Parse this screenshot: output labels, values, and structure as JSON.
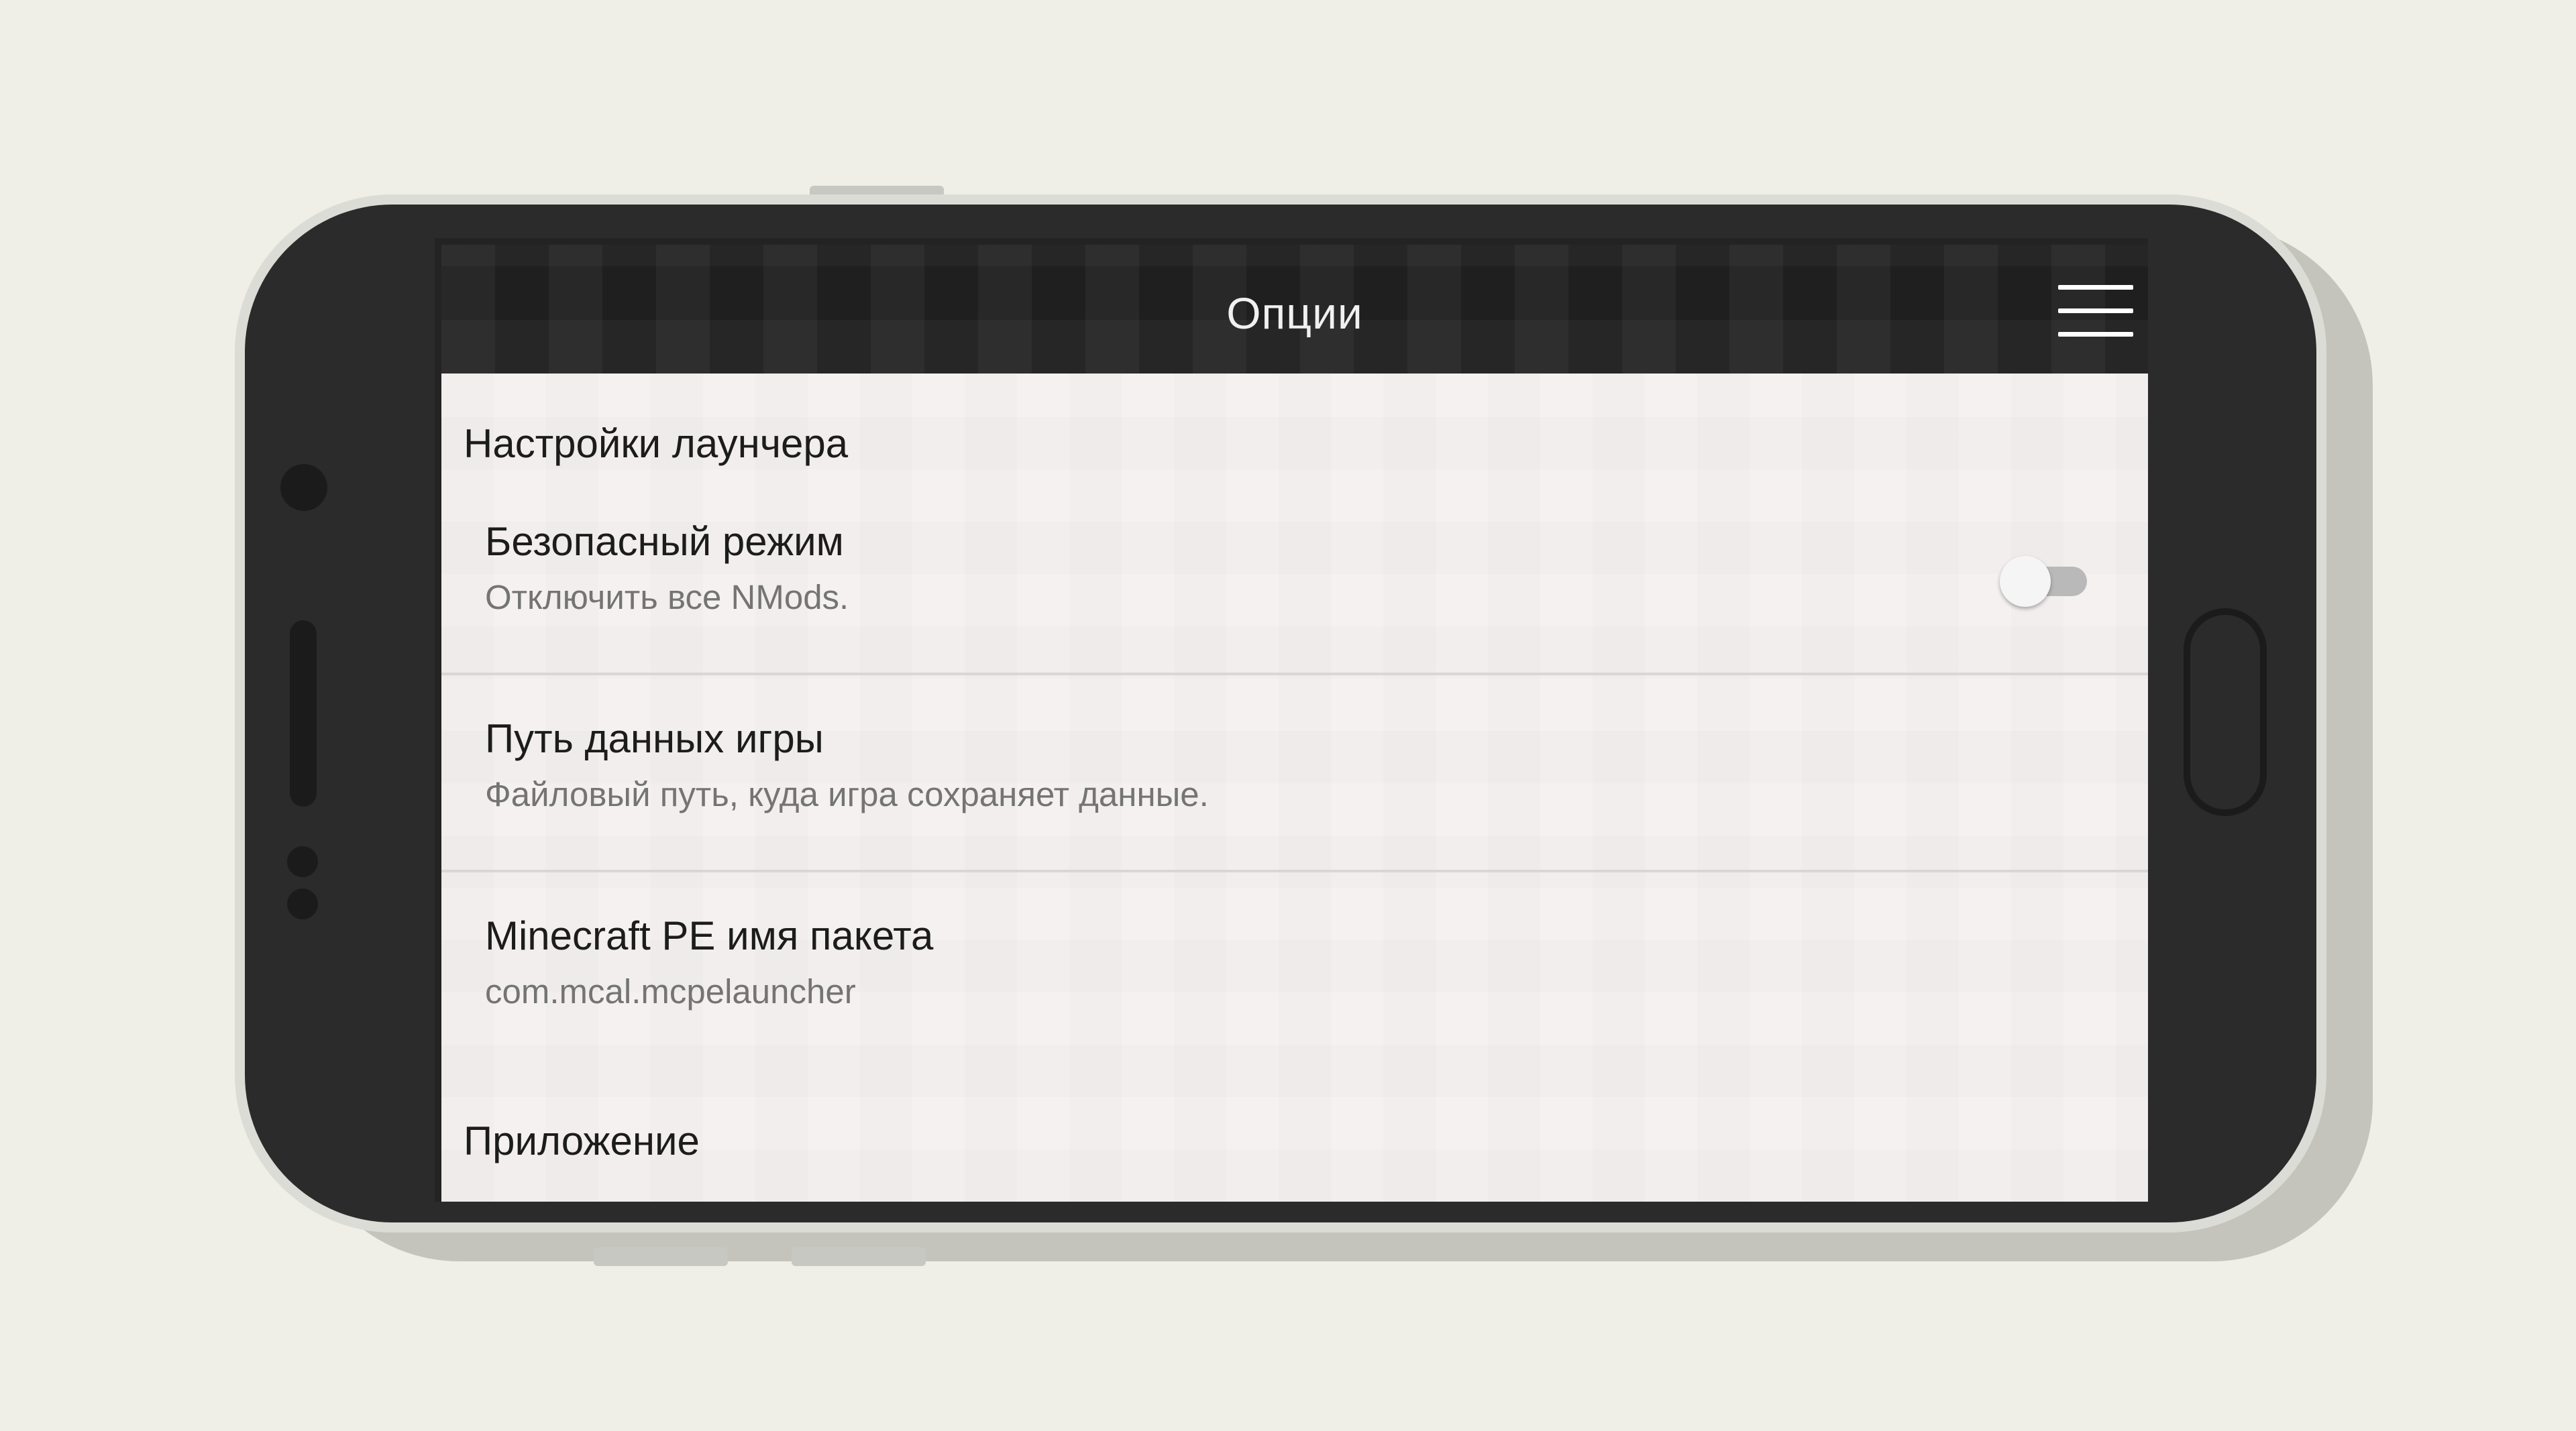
{
  "app_bar": {
    "title": "Опции",
    "menu_icon": "hamburger-menu-icon"
  },
  "sections": [
    {
      "header": "Настройки лаунчера",
      "items": [
        {
          "title": "Безопасный режим",
          "summary": "Отключить все NMods.",
          "switch_on": false
        },
        {
          "title": "Путь данных игры",
          "summary": "Файловый путь, куда игра сохраняет данные."
        },
        {
          "title": "Minecraft PE имя пакета",
          "summary": "com.mcal.mcpelauncher"
        }
      ]
    },
    {
      "header": "Приложение"
    }
  ],
  "colors": {
    "background": "#efefe8",
    "phone_body": "#2b2b2b",
    "app_bar": "#1f1f1f",
    "content": "#f4f1f0",
    "switch_track_off": "#b9b9b9"
  }
}
